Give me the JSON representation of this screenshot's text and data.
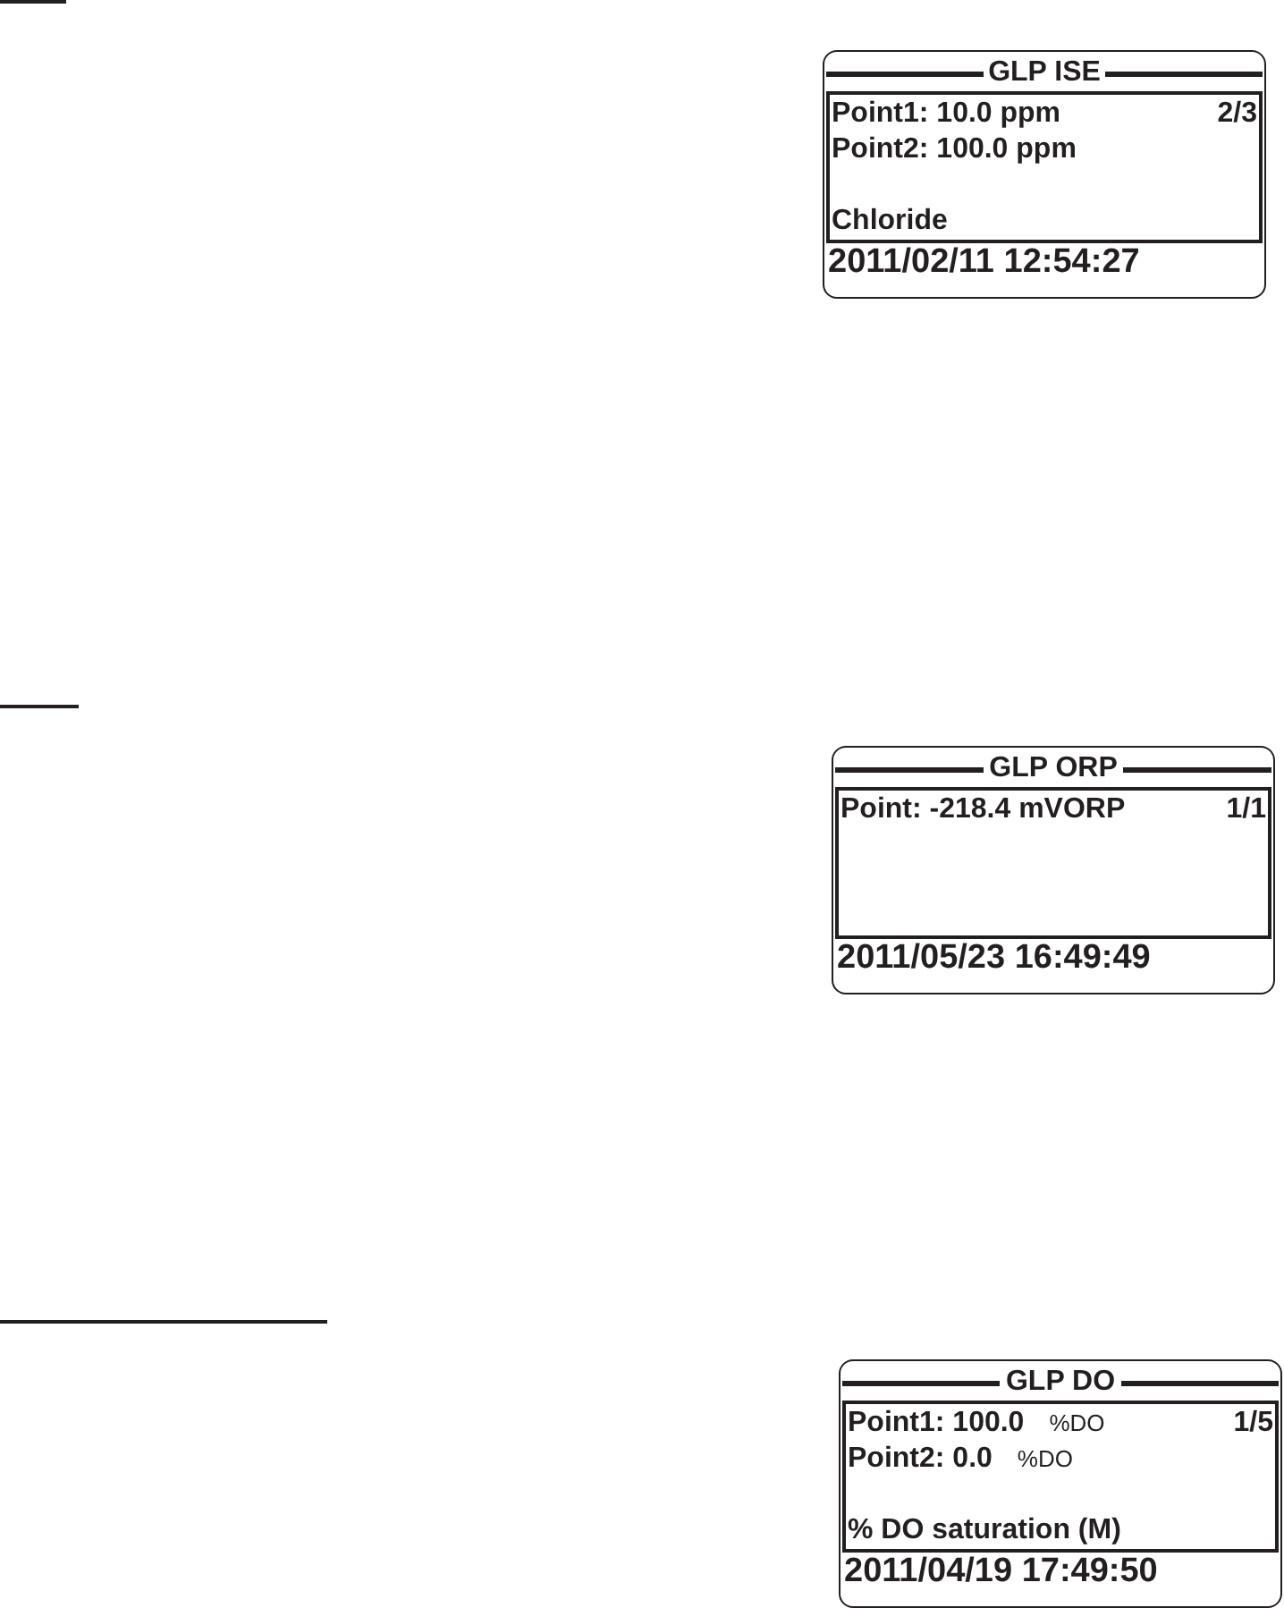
{
  "screens": [
    {
      "title": "GLP ISE",
      "counter": "2/3",
      "points": [
        {
          "reading": "Point1: 10.0 ppm"
        },
        {
          "reading": "Point2: 100.0 ppm"
        }
      ],
      "note": "Chloride",
      "timestamp": "2011/02/11 12:54:27"
    },
    {
      "title": "GLP ORP",
      "counter": "1/1",
      "points": [
        {
          "reading": "Point: -218.4 mVORP"
        }
      ],
      "timestamp": "2011/05/23 16:49:49"
    },
    {
      "title": "GLP DO",
      "counter": "1/5",
      "points": [
        {
          "reading": "Point1: 100.0",
          "unit": "%DO"
        },
        {
          "reading": "Point2: 0.0",
          "unit": "%DO"
        }
      ],
      "note": "% DO saturation (M)",
      "timestamp": "2011/04/19 17:49:50"
    }
  ]
}
